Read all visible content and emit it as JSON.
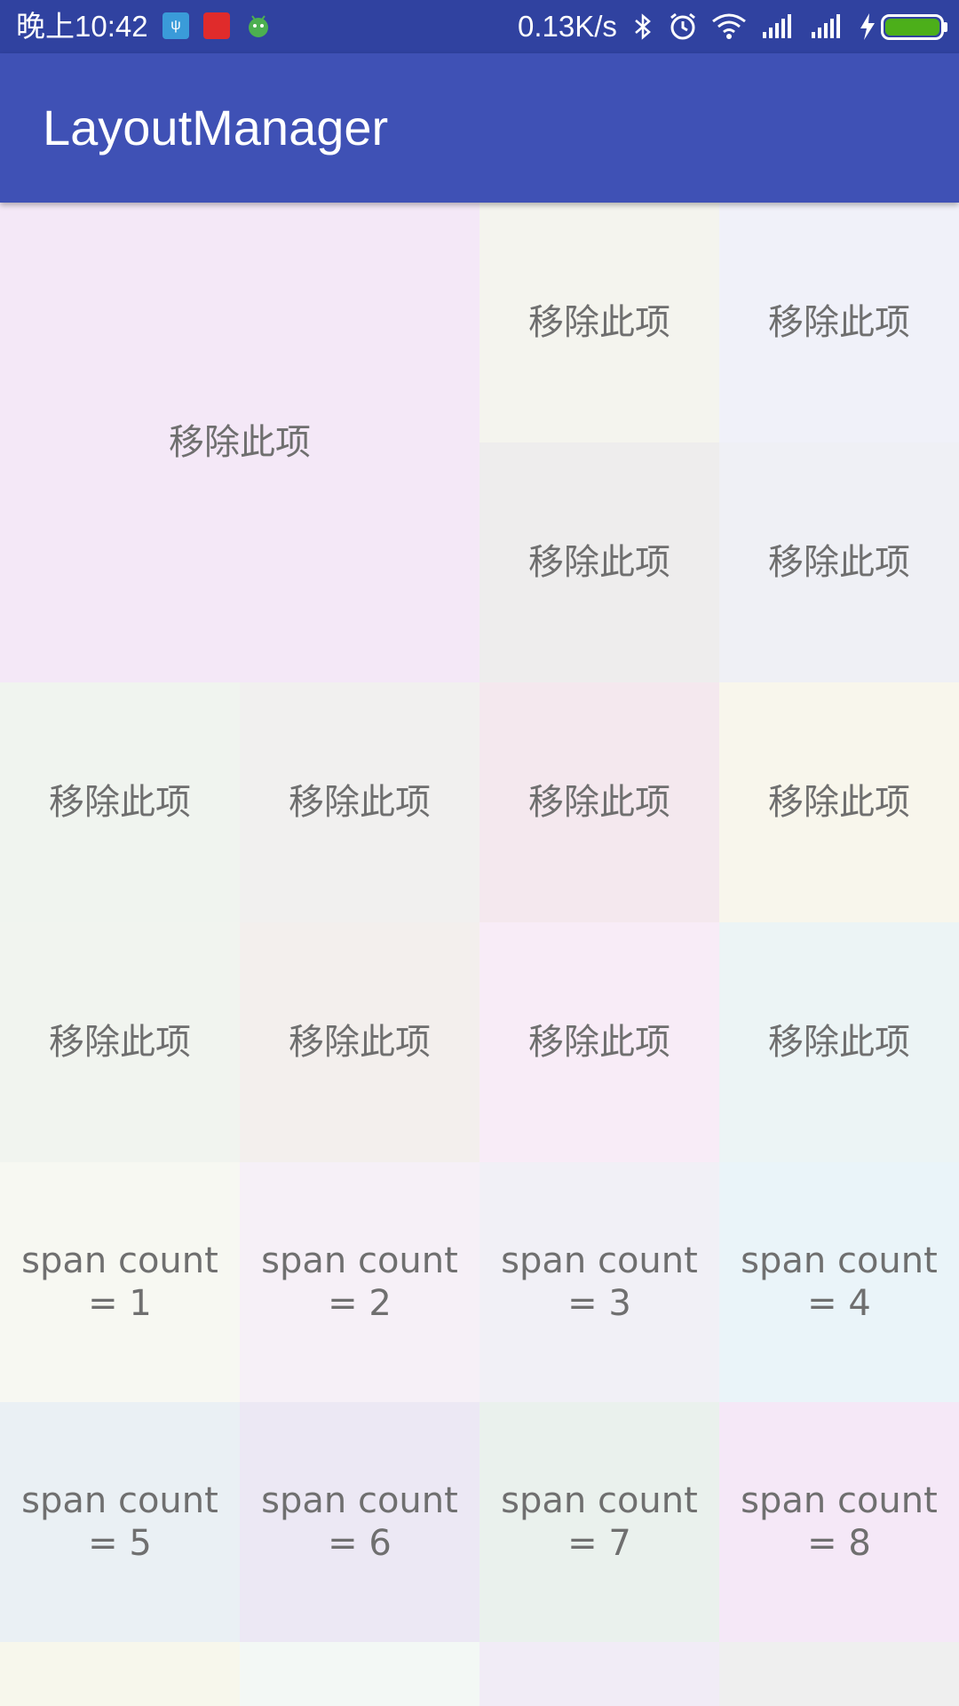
{
  "status_bar": {
    "time": "晚上10:42",
    "network_speed": "0.13K/s",
    "left_icons": [
      "usb-debug-icon",
      "toutiao-app-icon",
      "android-icon"
    ],
    "right_icons": [
      "bluetooth-icon",
      "alarm-icon",
      "wifi-icon",
      "signal-icon",
      "signal-icon",
      "charging-icon",
      "battery-icon"
    ],
    "battery_color": "#4caf1a"
  },
  "app_bar": {
    "title": "LayoutManager",
    "color": "#3f51b5"
  },
  "grid": {
    "tiles": [
      {
        "label": "移除此项",
        "color": "#f4e8f7"
      },
      {
        "label": "移除此项",
        "color": "#f4f4ee"
      },
      {
        "label": "移除此项",
        "color": "#f0f1f9"
      },
      {
        "label": "移除此项",
        "color": "#eeeded"
      },
      {
        "label": "移除此项",
        "color": "#eff0f5"
      },
      {
        "label": "移除此项",
        "color": "#f0f4ef"
      },
      {
        "label": "移除此项",
        "color": "#f1f0ef"
      },
      {
        "label": "移除此项",
        "color": "#f4e8ee"
      },
      {
        "label": "移除此项",
        "color": "#f8f6ec"
      },
      {
        "label": "移除此项",
        "color": "#f1f4ef"
      },
      {
        "label": "移除此项",
        "color": "#f3efed"
      },
      {
        "label": "移除此项",
        "color": "#f8ecf7"
      },
      {
        "label": "移除此项",
        "color": "#ecf4f5"
      }
    ],
    "span_buttons": [
      {
        "label": "span count\n= 1",
        "color": "#f7f8f2"
      },
      {
        "label": "span count\n= 2",
        "color": "#f6f0f7"
      },
      {
        "label": "span count\n= 3",
        "color": "#f1f0f6"
      },
      {
        "label": "span count\n= 4",
        "color": "#eaf4f9"
      },
      {
        "label": "span count\n= 5",
        "color": "#eaf0f4"
      },
      {
        "label": "span count\n= 6",
        "color": "#ece8f4"
      },
      {
        "label": "span count\n= 7",
        "color": "#eaf1ed"
      },
      {
        "label": "span count\n= 8",
        "color": "#f5e8f7"
      }
    ],
    "partial_row_colors": [
      "#f7f7ec",
      "#f3f8f5",
      "#f1ecf6",
      "#efefef"
    ]
  }
}
